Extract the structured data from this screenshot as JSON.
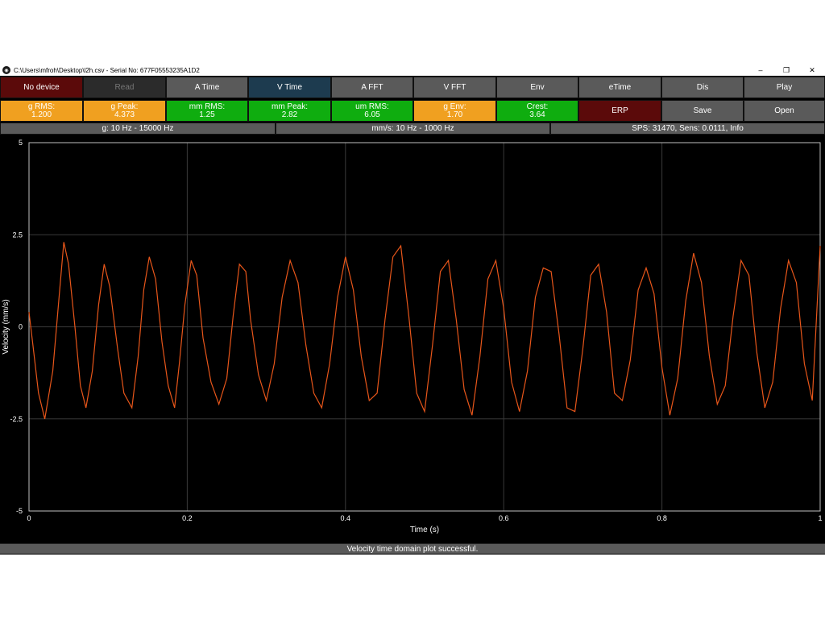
{
  "window": {
    "title": "C:\\Users\\mfroh\\Desktop\\l2h.csv - Serial No: 677F05553235A1D2",
    "app_icon": "app-logo-icon",
    "controls": {
      "minimize": "–",
      "restore": "❐",
      "close": "✕"
    }
  },
  "toolbar": {
    "items": [
      {
        "label": "No device",
        "state": "device-status"
      },
      {
        "label": "Read",
        "state": "disabled"
      },
      {
        "label": "A Time",
        "state": "normal"
      },
      {
        "label": "V Time",
        "state": "selected"
      },
      {
        "label": "A FFT",
        "state": "normal"
      },
      {
        "label": "V FFT",
        "state": "normal"
      },
      {
        "label": "Env",
        "state": "normal"
      },
      {
        "label": "eTime",
        "state": "normal"
      },
      {
        "label": "Dis",
        "state": "normal"
      },
      {
        "label": "Play",
        "state": "normal"
      }
    ]
  },
  "metrics": {
    "items": [
      {
        "label": "g RMS:",
        "value": "1.200",
        "color": "#f0a020"
      },
      {
        "label": "g Peak:",
        "value": "4.373",
        "color": "#f0a020"
      },
      {
        "label": "mm RMS:",
        "value": "1.25",
        "color": "#0fad0f"
      },
      {
        "label": "mm Peak:",
        "value": "2.82",
        "color": "#0fad0f"
      },
      {
        "label": "um RMS:",
        "value": "6.05",
        "color": "#0fad0f"
      },
      {
        "label": "g Env:",
        "value": "1.70",
        "color": "#f0a020"
      },
      {
        "label": "Crest:",
        "value": "3.64",
        "color": "#0fad0f"
      }
    ],
    "erp_label": "ERP",
    "save_label": "Save",
    "open_label": "Open"
  },
  "info": {
    "g_range": "g: 10 Hz - 15000 Hz",
    "mms_range": "mm/s: 10 Hz - 1000 Hz",
    "sps": "SPS: 31470, Sens: 0.0111, Info"
  },
  "status": "Velocity time domain plot successful.",
  "chart_data": {
    "type": "line",
    "title": "",
    "xlabel": "Time (s)",
    "ylabel": "Velocity (mm/s)",
    "xlim": [
      0,
      1
    ],
    "ylim": [
      -5,
      5
    ],
    "x_ticks": [
      "0",
      "0.2",
      "0.4",
      "0.6",
      "0.8",
      "1"
    ],
    "y_ticks": [
      "5",
      "2.5",
      "0",
      "-2.5",
      "-5"
    ],
    "grid": true,
    "line_color": "#e8561a",
    "series": [
      {
        "x": [
          0,
          0.005,
          0.012,
          0.02,
          0.03,
          0.038,
          0.044,
          0.05,
          0.058,
          0.065,
          0.072,
          0.08,
          0.088,
          0.095,
          0.102,
          0.112,
          0.12,
          0.13,
          0.138,
          0.145,
          0.152,
          0.16,
          0.168,
          0.176,
          0.184,
          0.19,
          0.197,
          0.205,
          0.212,
          0.22,
          0.23,
          0.24,
          0.25,
          0.258,
          0.266,
          0.274,
          0.28,
          0.29,
          0.3,
          0.31,
          0.32,
          0.33,
          0.34,
          0.35,
          0.36,
          0.37,
          0.38,
          0.39,
          0.4,
          0.41,
          0.42,
          0.43,
          0.44,
          0.45,
          0.46,
          0.47,
          0.48,
          0.49,
          0.5,
          0.51,
          0.52,
          0.53,
          0.54,
          0.55,
          0.56,
          0.57,
          0.58,
          0.59,
          0.6,
          0.61,
          0.62,
          0.63,
          0.64,
          0.65,
          0.66,
          0.67,
          0.68,
          0.69,
          0.7,
          0.71,
          0.72,
          0.73,
          0.74,
          0.75,
          0.76,
          0.77,
          0.78,
          0.79,
          0.8,
          0.81,
          0.82,
          0.83,
          0.84,
          0.85,
          0.86,
          0.87,
          0.88,
          0.89,
          0.9,
          0.91,
          0.92,
          0.93,
          0.94,
          0.95,
          0.96,
          0.97,
          0.98,
          0.99,
          1.0
        ],
        "values": [
          0.4,
          -0.5,
          -1.8,
          -2.5,
          -1.2,
          0.8,
          2.3,
          1.7,
          0.0,
          -1.6,
          -2.2,
          -1.2,
          0.6,
          1.7,
          1.1,
          -0.6,
          -1.8,
          -2.2,
          -0.8,
          1.0,
          1.9,
          1.3,
          -0.4,
          -1.6,
          -2.2,
          -1.0,
          0.6,
          1.8,
          1.4,
          -0.3,
          -1.5,
          -2.1,
          -1.4,
          0.3,
          1.7,
          1.5,
          0.2,
          -1.3,
          -2.0,
          -1.0,
          0.8,
          1.8,
          1.2,
          -0.5,
          -1.8,
          -2.2,
          -1.0,
          0.8,
          1.9,
          1.0,
          -0.8,
          -2.0,
          -1.8,
          0.2,
          1.9,
          2.2,
          0.3,
          -1.8,
          -2.3,
          -0.5,
          1.5,
          1.8,
          0.2,
          -1.7,
          -2.4,
          -0.8,
          1.3,
          1.8,
          0.5,
          -1.5,
          -2.3,
          -1.2,
          0.8,
          1.6,
          1.5,
          -0.2,
          -2.2,
          -2.3,
          -0.6,
          1.4,
          1.7,
          0.4,
          -1.8,
          -2.0,
          -0.9,
          1.0,
          1.6,
          0.9,
          -1.1,
          -2.4,
          -1.4,
          0.7,
          2.0,
          1.2,
          -0.8,
          -2.1,
          -1.6,
          0.3,
          1.8,
          1.4,
          -0.7,
          -2.2,
          -1.5,
          0.5,
          1.8,
          1.2,
          -1.0,
          -2.0,
          2.2
        ]
      }
    ]
  }
}
